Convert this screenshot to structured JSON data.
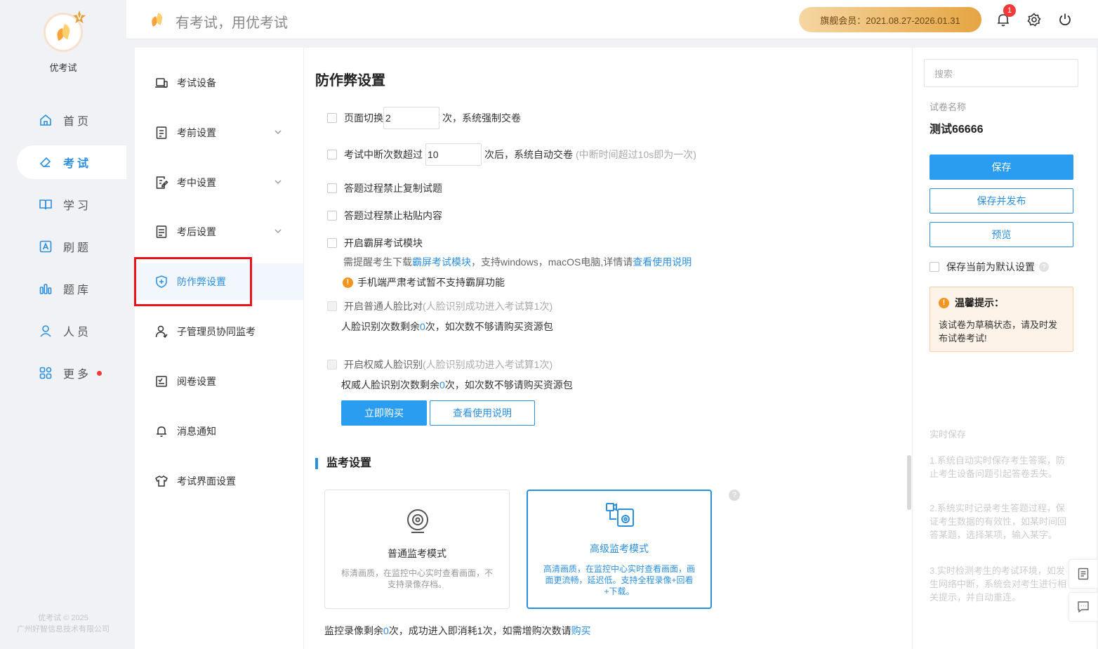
{
  "brand": {
    "name": "优考试",
    "vip_mark": "V"
  },
  "nav": {
    "items": [
      {
        "label": "首页",
        "icon": "home-icon"
      },
      {
        "label": "考试",
        "icon": "eraser-icon",
        "active": true
      },
      {
        "label": "学习",
        "icon": "book-icon"
      },
      {
        "label": "刷题",
        "icon": "a-square-icon"
      },
      {
        "label": "题库",
        "icon": "bars-icon"
      },
      {
        "label": "人员",
        "icon": "user-icon"
      },
      {
        "label": "更多",
        "icon": "grid-icon",
        "dot": true
      }
    ],
    "copyright_line1": "优考试 © 2025",
    "copyright_line2": "广州好智信息技术有限公司"
  },
  "header": {
    "slogan": "有考试，用优考试",
    "vip_text": "旗舰会员：2021.08.27-2026.01.31",
    "notification_count": "1"
  },
  "subnav": {
    "items": [
      {
        "label": "考试设备",
        "icon": "laptop-icon"
      },
      {
        "label": "考前设置",
        "icon": "doc-icon",
        "expand": true
      },
      {
        "label": "考中设置",
        "icon": "edit-doc-icon",
        "expand": true
      },
      {
        "label": "考后设置",
        "icon": "score-doc-icon",
        "expand": true
      },
      {
        "label": "防作弊设置",
        "icon": "shield-icon",
        "active": true
      },
      {
        "label": "子管理员协同监考",
        "icon": "users-icon"
      },
      {
        "label": "阅卷设置",
        "icon": "review-icon"
      },
      {
        "label": "消息通知",
        "icon": "bell-icon"
      },
      {
        "label": "考试界面设置",
        "icon": "shirt-icon"
      }
    ]
  },
  "content": {
    "title": "防作弊设置",
    "page_switch": {
      "label": "页面切换",
      "value": "2",
      "suffix": "次，系统强制交卷"
    },
    "interrupt": {
      "label": "考试中断次数超过",
      "value": "10",
      "suffix": "次后，系统自动交卷",
      "hint": "(中断时间超过10s即为一次)"
    },
    "no_copy": "答题过程禁止复制试题",
    "no_paste": "答题过程禁止粘贴内容",
    "fullscreen": {
      "label": "开启霸屏考试模块",
      "note_pre": "需提醒考生下载",
      "note_link1": "霸屏考试模块",
      "note_mid": "，支持windows，macOS电脑,详情请",
      "note_link2": "查看使用说明",
      "warning": "手机端严肃考试暂不支持霸屏功能"
    },
    "face_normal": {
      "label": "开启普通人脸比对",
      "hint": "(人脸识别成功进入考试算1次)",
      "remain_pre": "人脸识别次数剩余",
      "remain_count": "0",
      "remain_post": "次，如次数不够请购买资源包"
    },
    "face_auth": {
      "label": "开启权威人脸识别",
      "hint": "(人脸识别成功进入考试算1次)",
      "remain_pre": "权威人脸识别次数剩余",
      "remain_count": "0",
      "remain_post": "次，如次数不够请购买资源包"
    },
    "buy_button": "立即购买",
    "guide_button": "查看使用说明",
    "monitor_title": "监考设置",
    "modes": [
      {
        "title": "普通监考模式",
        "desc": "标清画质，在监控中心实时查看画面，不支持录像存档。",
        "icon": "webcam-icon"
      },
      {
        "title": "高级监考模式",
        "desc": "高清画质，在监控中心实时查看画面，画面更流畅，延迟低。支持全程录像+回看+下载。",
        "icon": "video-monitor-icon",
        "selected": true
      }
    ],
    "help_mark": "?",
    "bottom_pre": "监控录像剩余",
    "bottom_count": "0",
    "bottom_mid": "次，成功进入即消耗1次，如需增购次数请",
    "bottom_link": "购买"
  },
  "right": {
    "search_placeholder": "搜索",
    "paper_label": "试卷名称",
    "paper_name": "测试66666",
    "save": "保存",
    "save_publish": "保存并发布",
    "preview": "预览",
    "default_setting": "保存当前为默认设置",
    "tip_title": "温馨提示：",
    "tip_text": "该试卷为草稿状态，请及时发布试卷考试!",
    "realtime_title": "实时保存",
    "realtime_1": "1.系统自动实时保存考生答案，防止考生设备问题引起答卷丢失。",
    "realtime_2": "2.系统实时记录考生答题过程，保证考生数据的有效性，如某时间回答某题，选择某项，输入某字。",
    "realtime_3": "3.实时检测考生的考试环境，如发生网络中断，系统会对考生进行相关提示，并自动重连。"
  },
  "colors": {
    "accent": "#2b8fe0",
    "warning": "#f5931f",
    "highlight_box": "#e8141a"
  }
}
